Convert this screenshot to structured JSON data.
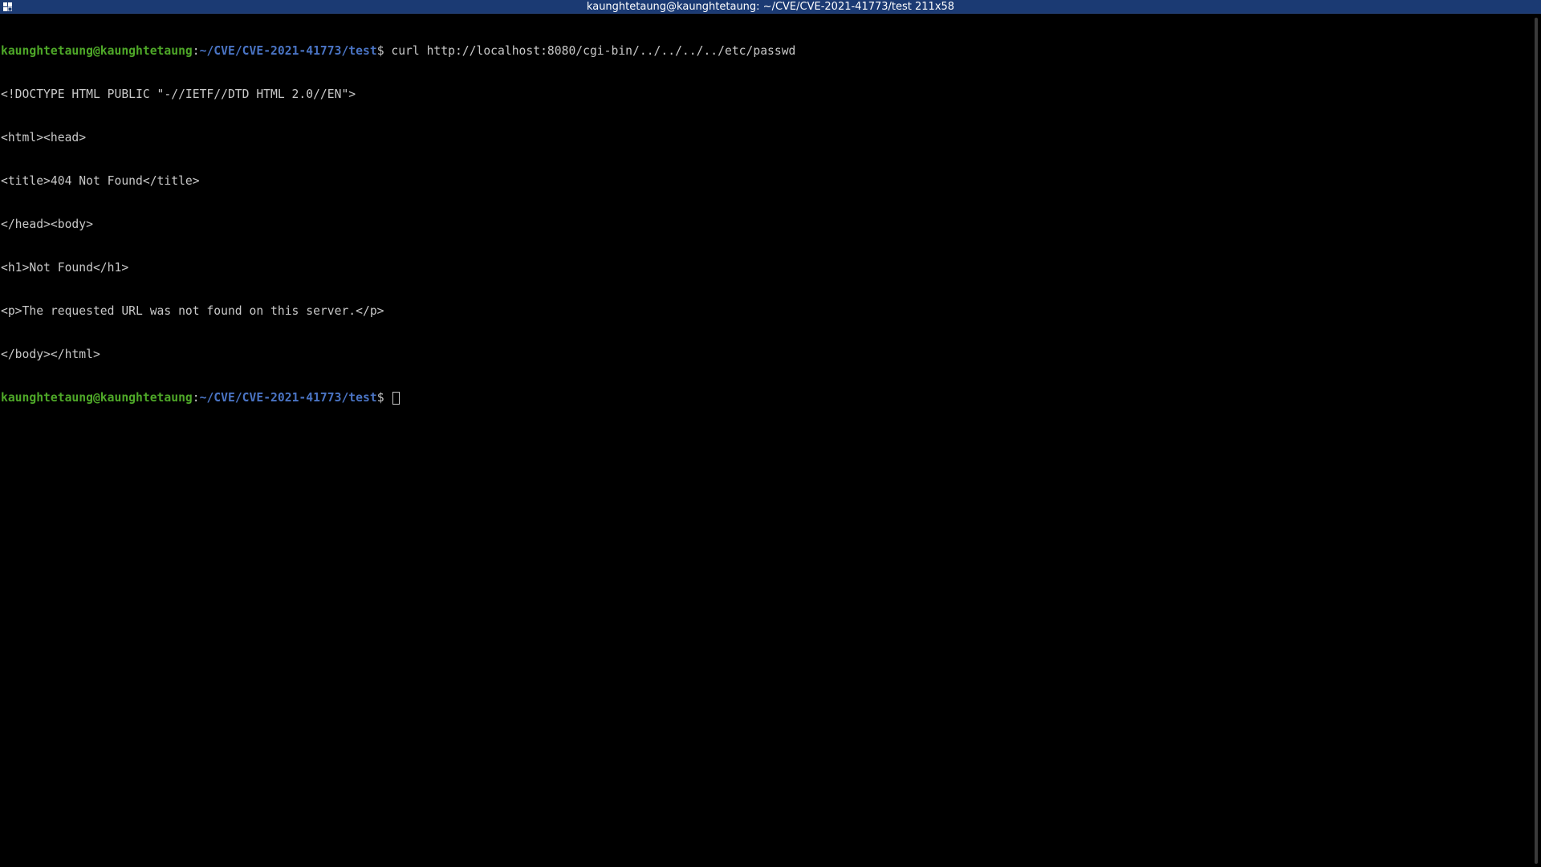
{
  "window": {
    "title": "kaunghtetaung@kaunghtetaung: ~/CVE/CVE-2021-41773/test 211x58",
    "menu_icon": "window-menu-icon"
  },
  "terminal": {
    "prompt_user": "kaunghtetaung@kaunghtetaung",
    "prompt_sep": ":",
    "prompt_path": "~/CVE/CVE-2021-41773/test",
    "prompt_dollar": "$",
    "command": " curl http://localhost:8080/cgi-bin/../../../../etc/passwd",
    "output": [
      "<!DOCTYPE HTML PUBLIC \"-//IETF//DTD HTML 2.0//EN\">",
      "<html><head>",
      "<title>404 Not Found</title>",
      "</head><body>",
      "<h1>Not Found</h1>",
      "<p>The requested URL was not found on this server.</p>",
      "</body></html>"
    ],
    "final_prompt_user": "kaunghtetaung@kaunghtetaung",
    "final_prompt_sep": ":",
    "final_prompt_path": "~/CVE/CVE-2021-41773/test",
    "final_prompt_dollar": "$ "
  },
  "colors": {
    "background": "#000000",
    "titlebar": "#1b3a73",
    "prompt_user": "#4ea828",
    "prompt_path": "#4a74c4",
    "text": "#c8c8c8"
  }
}
